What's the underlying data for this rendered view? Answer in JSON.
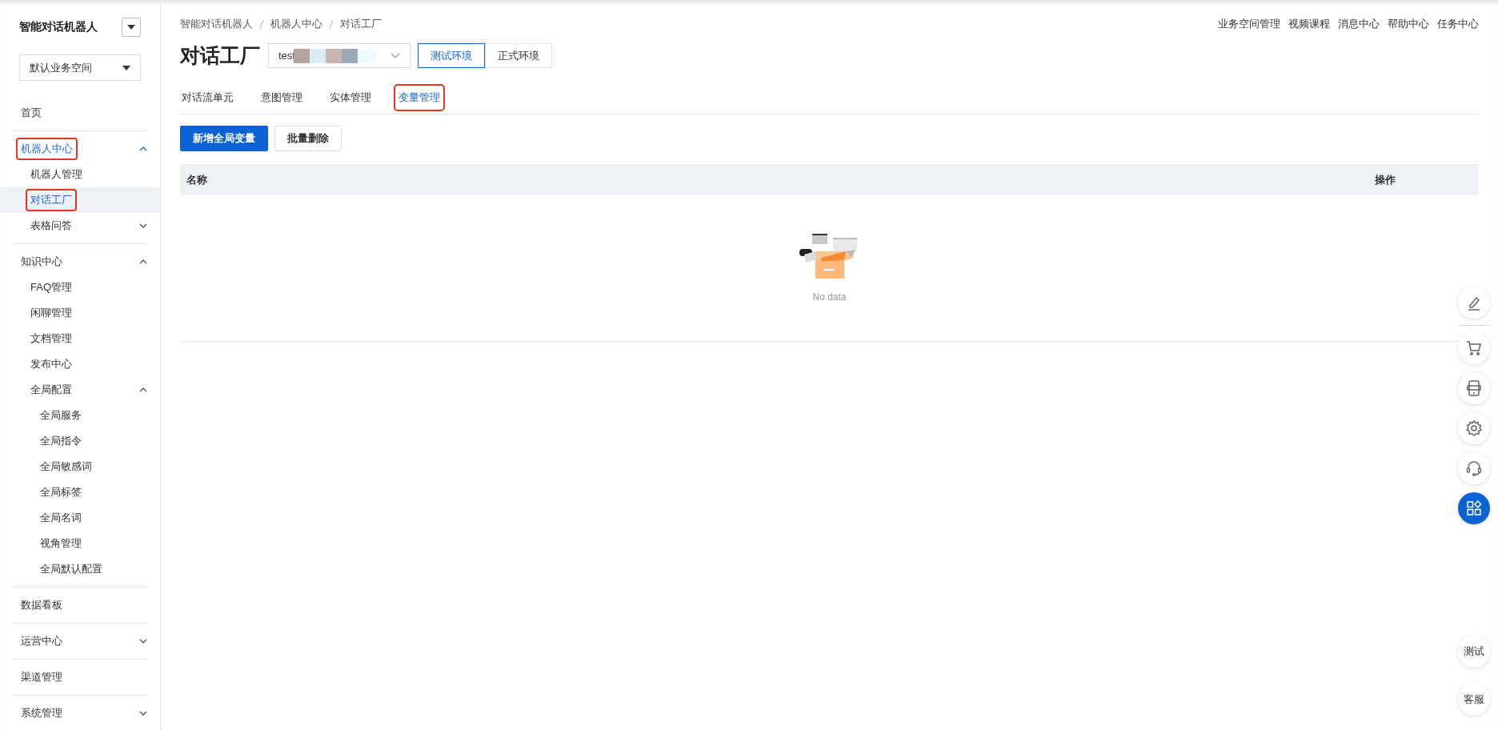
{
  "sidebar": {
    "app_title": "智能对话机器人",
    "workspace": "默认业务空间",
    "menu": [
      {
        "label": "首页",
        "selected": false
      },
      {
        "label": "机器人中心",
        "selected": false,
        "expanded": true,
        "annotated": true,
        "children": [
          {
            "label": "机器人管理",
            "selected": false
          },
          {
            "label": "对话工厂",
            "selected": true,
            "annotated": true
          },
          {
            "label": "表格问答",
            "selected": false,
            "expanded": false
          }
        ]
      },
      {
        "label": "知识中心",
        "selected": false,
        "expanded": true,
        "children": [
          {
            "label": "FAQ管理",
            "selected": false
          },
          {
            "label": "闲聊管理",
            "selected": false
          },
          {
            "label": "文档管理",
            "selected": false
          },
          {
            "label": "发布中心",
            "selected": false
          },
          {
            "label": "全局配置",
            "selected": false,
            "expanded": true,
            "children": [
              {
                "label": "全局服务",
                "selected": false
              },
              {
                "label": "全局指令",
                "selected": false
              },
              {
                "label": "全局敏感词",
                "selected": false
              },
              {
                "label": "全局标签",
                "selected": false
              },
              {
                "label": "全局名词",
                "selected": false
              },
              {
                "label": "视角管理",
                "selected": false
              },
              {
                "label": "全局默认配置",
                "selected": false
              }
            ]
          }
        ]
      },
      {
        "label": "数据看板",
        "selected": false
      },
      {
        "label": "运营中心",
        "selected": false,
        "expanded": false
      },
      {
        "label": "渠道管理",
        "selected": false
      },
      {
        "label": "系统管理",
        "selected": false,
        "expanded": false
      }
    ]
  },
  "breadcrumb": [
    "智能对话机器人",
    "机器人中心",
    "对话工厂"
  ],
  "top_links": [
    "业务空间管理",
    "视频课程",
    "消息中心",
    "帮助中心",
    "任务中心"
  ],
  "page_title": "对话工厂",
  "bot_select": {
    "value": "test"
  },
  "environments": [
    {
      "label": "测试环境",
      "selected": true
    },
    {
      "label": "正式环境",
      "selected": false
    }
  ],
  "tabs": [
    {
      "label": "对话流单元",
      "selected": false
    },
    {
      "label": "意图管理",
      "selected": false
    },
    {
      "label": "实体管理",
      "selected": false
    },
    {
      "label": "变量管理",
      "selected": true,
      "annotated": true
    }
  ],
  "buttons": [
    {
      "label": "新增全局变量",
      "kind": "primary"
    },
    {
      "label": "批量删除",
      "kind": "default"
    }
  ],
  "table": {
    "columns": [
      "名称",
      "操作"
    ],
    "empty_text": "No data"
  },
  "tool_buttons": [
    {
      "selected": false
    },
    {
      "selected": false
    },
    {
      "selected": false
    },
    {
      "selected": false
    },
    {
      "selected": false
    },
    {
      "selected": true
    }
  ],
  "text_buttons": [
    "测试",
    "客服"
  ]
}
